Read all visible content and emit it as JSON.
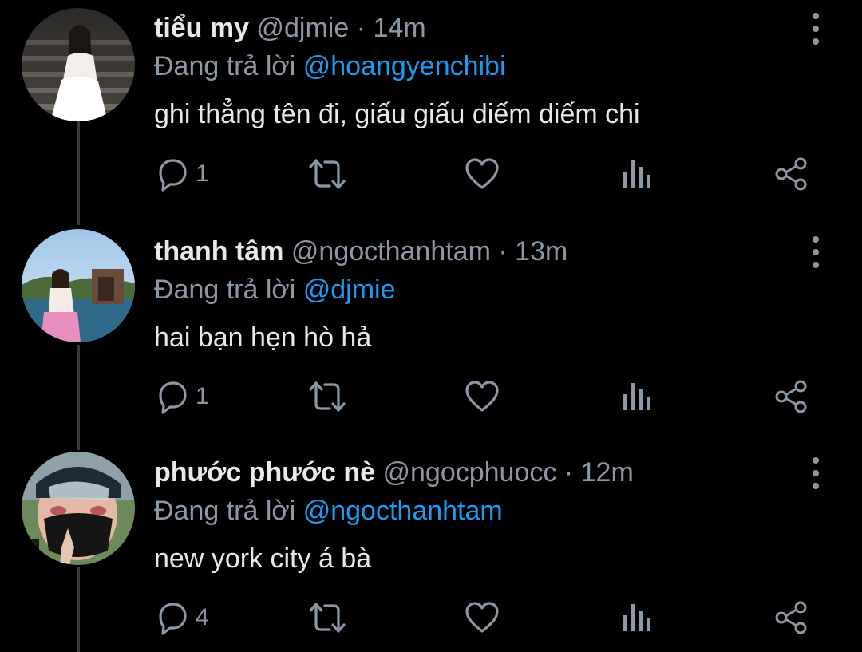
{
  "tweets": [
    {
      "name": "tiểu my",
      "handle": "@djmie",
      "separator": "·",
      "time": "14m",
      "replying_prefix": "Đang trả lời",
      "replying_to": "@hoangyenchibi",
      "text": "ghi thẳng tên đi, giấu giấu diếm diếm chi",
      "reply_count": "1",
      "icons": [
        "reply-icon",
        "retweet-icon",
        "like-icon",
        "analytics-icon",
        "share-icon",
        "more-icon"
      ]
    },
    {
      "name": "thanh tâm",
      "handle": "@ngocthanhtam",
      "separator": "·",
      "time": "13m",
      "replying_prefix": "Đang trả lời",
      "replying_to": "@djmie",
      "text": "hai bạn hẹn hò hả",
      "reply_count": "1",
      "icons": [
        "reply-icon",
        "retweet-icon",
        "like-icon",
        "analytics-icon",
        "share-icon",
        "more-icon"
      ]
    },
    {
      "name": "phước phước nè",
      "handle": "@ngocphuocc",
      "separator": "·",
      "time": "12m",
      "replying_prefix": "Đang trả lời",
      "replying_to": "@ngocthanhtam",
      "text": "new york city á bà",
      "reply_count": "4",
      "icons": [
        "reply-icon",
        "retweet-icon",
        "like-icon",
        "analytics-icon",
        "share-icon",
        "more-icon"
      ]
    }
  ],
  "colors": {
    "background": "#000000",
    "text": "#e7e9ea",
    "secondary": "#8b98a5",
    "mention": "#1d9bf0",
    "thread_line": "#3a3b3c"
  }
}
